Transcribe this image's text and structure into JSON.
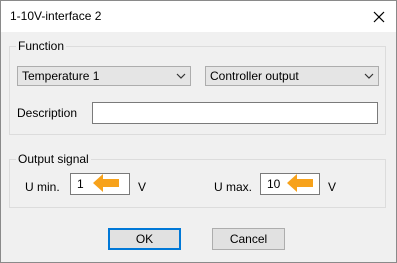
{
  "window": {
    "title": "1-10V-interface 2",
    "close_icon": "close-icon"
  },
  "function_group": {
    "label": "Function",
    "source_select": {
      "value": "Temperature 1"
    },
    "output_select": {
      "value": "Controller output"
    },
    "description_label": "Description",
    "description_value": ""
  },
  "output_group": {
    "label": "Output signal",
    "umin_label": "U min.",
    "umin_value": "1",
    "umin_unit": "V",
    "umax_label": "U max.",
    "umax_value": "10",
    "umax_unit": "V"
  },
  "buttons": {
    "ok": "OK",
    "cancel": "Cancel"
  },
  "colors": {
    "accent": "#0078d7",
    "arrow": "#f7a21b",
    "titlebar": "#ffffff",
    "dialog_bg": "#f0f0f0"
  }
}
